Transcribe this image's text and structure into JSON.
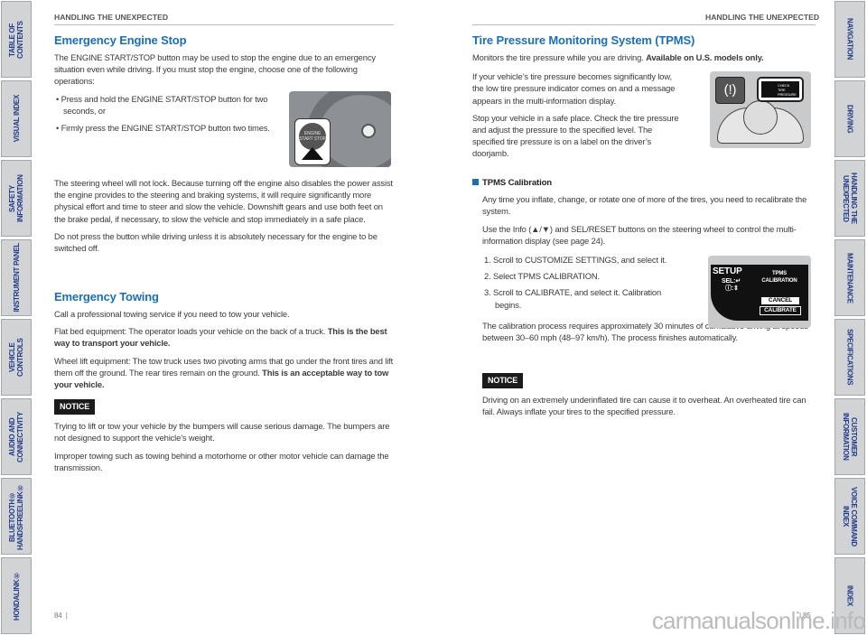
{
  "left_tabs": [
    "TABLE OF CONTENTS",
    "VISUAL INDEX",
    "SAFETY INFORMATION",
    "INSTRUMENT PANEL",
    "VEHICLE CONTROLS",
    "AUDIO AND CONNECTIVITY",
    "BLUETOOTH® HANDSFREELINK®",
    "HONDALINK®"
  ],
  "right_tabs": [
    "NAVIGATION",
    "DRIVING",
    "HANDLING THE UNEXPECTED",
    "MAINTENANCE",
    "SPECIFICATIONS",
    "CUSTOMER INFORMATION",
    "VOICE COMMAND INDEX",
    "INDEX"
  ],
  "left": {
    "header": "HANDLING THE UNEXPECTED",
    "ees": {
      "title": "Emergency Engine Stop",
      "intro": "The ENGINE START/STOP button may be used to stop the engine due to an emergency situation even while driving. If you must stop the engine, choose one of the following operations:",
      "bullets": [
        "Press and hold the ENGINE START/STOP button for two seconds, or",
        "Firmly press the ENGINE START/STOP button two times."
      ],
      "p1": "The steering wheel will not lock. Because turning off the engine also disables the power assist the engine provides to the steering and braking systems, it will require significantly more physical effort and time to steer and slow the vehicle. Downshift gears and use both feet on the brake pedal, if necessary, to slow the vehicle and stop immediately in a safe place.",
      "p2": "Do not press the button while driving unless it is absolutely necessary for the engine to be switched off.",
      "image_label": "ENGINE START STOP"
    },
    "tow": {
      "title": "Emergency Towing",
      "p1": "Call a professional towing service if you need to tow your vehicle.",
      "p2": "Flat bed equipment: The operator loads your vehicle on the back of a truck.",
      "p2b": "This is the best way to transport your vehicle.",
      "p3": "Wheel lift equipment: The tow truck uses two pivoting arms that go under the front tires and lift them off the ground. The rear tires remain on the ground.",
      "p3b": "This is an acceptable way to tow your vehicle.",
      "notice": "NOTICE",
      "n1": "Trying to lift or tow your vehicle by the bumpers will cause serious damage. The bumpers are not designed to support the vehicle’s weight.",
      "n2": "Improper towing such as towing behind a motorhome or other motor vehicle can damage the transmission."
    },
    "page": "84"
  },
  "right": {
    "header": "HANDLING THE UNEXPECTED",
    "title": "Tire Pressure Monitoring System (TPMS)",
    "sub": "Monitors the tire pressure while you are driving.",
    "sub_b": "Available on U.S. models only.",
    "p1": "If your vehicle’s tire pressure becomes significantly low, the low tire pressure indicator comes on and a message appears in the multi-information display.",
    "p2": "Stop your vehicle in a safe place. Check the tire pressure and adjust the pressure to the specified level. The specified tire pressure is on a label on the driver’s doorjamb.",
    "cal": {
      "title": "TPMS Calibration",
      "p1": "Any time you inflate, change, or rotate one of more of the tires, you need to recalibrate the system.",
      "p2": "Use the Info (▲/▼) and SEL/RESET buttons on the steering wheel to control the multi-information display (see page 24).",
      "steps": [
        "1. Scroll to CUSTOMIZE SETTINGS, and select it.",
        "2. Select TPMS CALIBRATION.",
        "3. Scroll to CALIBRATE, and select it. Calibration begins."
      ],
      "p3": "The calibration process requires approximately 30 minutes of cumulative driving at speeds between 30–60 mph (48–97 km/h). The process finishes automatically."
    },
    "screen": {
      "setup": "SETUP",
      "sel": "SEL:↵",
      "info": "ⓘ:⇕",
      "title": "TPMS CALIBRATION",
      "cancel": "CANCEL",
      "calibrate": "CALIBRATE"
    },
    "cluster_msg": "CHECK TIRE PRESSURE",
    "notice": "NOTICE",
    "n1": "Driving on an extremely underinflated tire can cause it to overheat. An overheated tire can fail. Always inflate your tires to the specified pressure.",
    "page": "85"
  },
  "watermark": "carmanualsonline.info"
}
